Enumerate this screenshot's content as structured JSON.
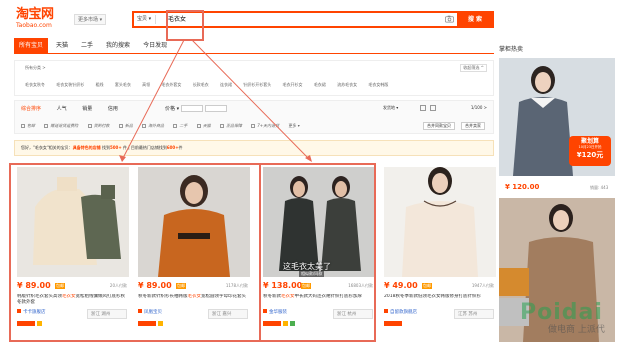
{
  "header": {
    "logo_cn": "淘宝网",
    "logo_en": "Taobao.com",
    "location": "更多市场 ▾",
    "search_type": "宝贝 ▾",
    "search_value": "毛衣女",
    "search_button": "搜 索"
  },
  "tabs": [
    {
      "label": "所有宝贝",
      "active": true
    },
    {
      "label": "天猫"
    },
    {
      "label": "二手"
    },
    {
      "label": "我的搜索"
    },
    {
      "label": "今日发现"
    }
  ],
  "side_title": "掌柜热卖",
  "filter": {
    "row1": "所有分类 >",
    "more": "收起筛选 ^",
    "row2": [
      "毛衣女秋冬",
      "毛衣女装针织衫",
      "粗线",
      "套头毛衣",
      "高领",
      "毛衣外套女",
      "长款毛衣",
      "连衣裙",
      "针织衫开衫套头",
      "毛衣开衫女",
      "毛衣裙",
      "流苏毛衣女",
      "毛衣女韩版",
      "毛衣女宽松"
    ]
  },
  "sort": {
    "items": [
      "综合排序",
      "人气",
      "销量",
      "信用"
    ],
    "price_label": "价格 ▾",
    "ship": "发货地 ▾",
    "page": "1/100 >",
    "checks": [
      "包邮",
      "赠送退货运费险",
      "货到付款",
      "新品",
      "海外商品",
      "二手",
      "天猫",
      "正品保障",
      "7+天内退货",
      "更多 ▾"
    ],
    "shop_btn1": "合并同款宝贝",
    "shop_btn2": "合并卖家"
  },
  "notice": {
    "prefix": "您好，\"毛衣女\"相关的宝贝：",
    "k1": "具备特色的店铺",
    "mid1": "找到",
    "n1": "500+",
    "mid2": "件 | 目前最热门店铺",
    "mid3": "找到",
    "n2": "600+",
    "suffix": "件"
  },
  "products": [
    {
      "price": "¥ 89.00",
      "tag": "包邮",
      "sold": "20人付款",
      "title_pre": "韩版针织毛衣套头高领",
      "title_hl": "毛衣女",
      "title_post": "宽松粗线慵懒风打底衫秋冬款外套",
      "shop": "卡卡旗舰店",
      "loc": "浙江 湖州"
    },
    {
      "price": "¥ 89.00",
      "tag": "包邮",
      "sold": "1178人付款",
      "title_pre": "秋冬新款针织衫长袖韩版",
      "title_hl": "毛衣女",
      "title_post": "宽松圆领字母印花套头",
      "shop": "凤凰宝贝",
      "loc": "浙江 嘉兴"
    },
    {
      "price": "¥ 138.00",
      "tag": "包邮",
      "sold": "16803人付款",
      "title_pre": "秋冬新款",
      "title_hl": "毛衣女",
      "title_post": "中长款大码连衣裙针织打底衫加厚",
      "shop": "金华服装",
      "loc": "浙江 杭州"
    },
    {
      "price": "¥ 49.00",
      "tag": "包邮",
      "sold": "1947人付款",
      "title_pre": "2018秋冬季新款低领毛衣女",
      "title_hl": "",
      "title_post": "韩版修身打底针织衫",
      "shop": "自留款旗舰店",
      "loc": "江苏 苏州"
    }
  ],
  "overlay_text": "这毛衣太美了",
  "overlay_sub": "相似款/同款",
  "side": [
    {
      "price": "¥ 120.00",
      "sold": "销量: 443",
      "promo": "聚划算",
      "promo_sub": "10月23日开抢",
      "promo_price": "¥120元"
    },
    {
      "price": "",
      "sold": ""
    }
  ],
  "watermark": "Poidai",
  "watermark_sub": "做电商 上派代",
  "colors": {
    "accent": "#ff4400"
  }
}
